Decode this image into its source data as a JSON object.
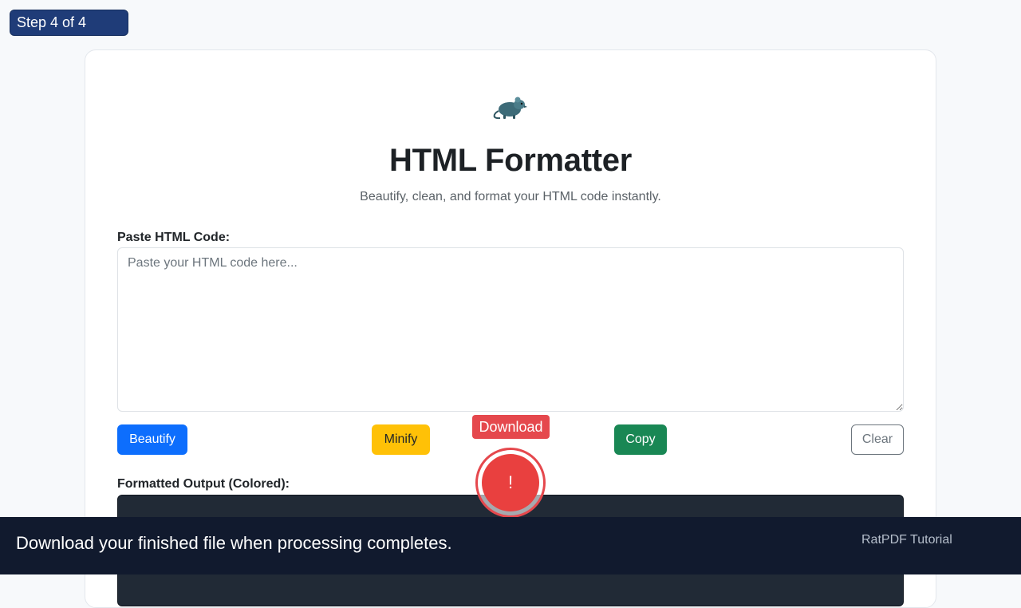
{
  "step_badge": "Step 4 of 4",
  "logo": {
    "icon": "rat-icon"
  },
  "header": {
    "title": "HTML Formatter",
    "subtitle": "Beautify, clean, and format your HTML code instantly."
  },
  "input": {
    "label": "Paste HTML Code:",
    "placeholder": "Paste your HTML code here...",
    "value": ""
  },
  "actions": {
    "beautify_label": "Beautify",
    "minify_label": "Minify",
    "copy_label": "Copy",
    "clear_label": "Clear"
  },
  "output": {
    "label": "Formatted Output (Colored):"
  },
  "tutorial": {
    "tooltip": "Download",
    "marker": "!",
    "message": "Download your finished file when processing completes.",
    "brand": "RatPDF Tutorial"
  },
  "colors": {
    "primary": "#0d6efd",
    "warning": "#ffc107",
    "success": "#198754",
    "highlight": "#e5484d",
    "tutorial_bar": "#111a2e",
    "step_badge": "#1f3c78"
  }
}
